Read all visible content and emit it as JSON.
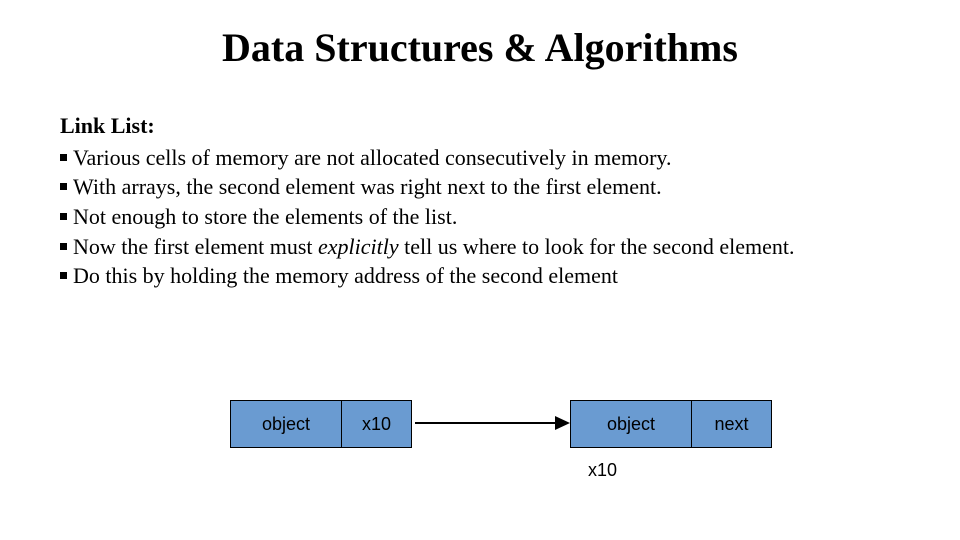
{
  "title": "Data Structures & Algorithms",
  "subhead": "Link List:",
  "bullets": [
    "Various cells of memory are not allocated consecutively in memory.",
    "With arrays, the second element was right next to the first element.",
    "Not enough to store the elements of the list.",
    "Now the first element must <i>explicitly</i> tell us where to look for the second element.",
    "Do this by holding the memory address of the second element"
  ],
  "diagram": {
    "node_a": {
      "left": "object",
      "right": "x10"
    },
    "node_b": {
      "left": "object",
      "right": "next"
    },
    "caption": "x10"
  }
}
